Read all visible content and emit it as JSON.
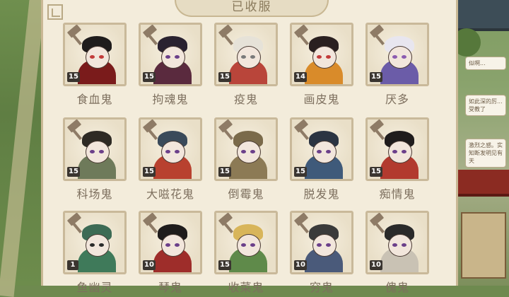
{
  "header": {
    "title": "已收服"
  },
  "ghosts": [
    {
      "name": "食血鬼",
      "level": "15",
      "color": "#7a1b1b",
      "hair": "#1f1c1c",
      "eye": "#c23b3b"
    },
    {
      "name": "拘魂鬼",
      "level": "15",
      "color": "#5a2a3e",
      "hair": "#2a2230",
      "eye": "#6b3f8a"
    },
    {
      "name": "疫鬼",
      "level": "15",
      "color": "#b9453a",
      "hair": "#e6e2d8",
      "eye": "#7a7a7a"
    },
    {
      "name": "画皮鬼",
      "level": "14",
      "color": "#d98b2a",
      "hair": "#2a2020",
      "eye": "#c23b3b"
    },
    {
      "name": "厌多",
      "level": "15",
      "color": "#6b5ca8",
      "hair": "#e8e6ef",
      "eye": "#8c5bb0"
    },
    {
      "name": "科场鬼",
      "level": "15",
      "color": "#6e7a5a",
      "hair": "#2e2a24",
      "eye": "#6b3f8a"
    },
    {
      "name": "大嗞花鬼",
      "level": "15",
      "color": "#b8412f",
      "hair": "#3a4a5a",
      "eye": "#6b3f8a"
    },
    {
      "name": "倒霉鬼",
      "level": "15",
      "color": "#8c7a55",
      "hair": "#7a6a4a",
      "eye": "#6b3f8a"
    },
    {
      "name": "脱发鬼",
      "level": "15",
      "color": "#3f5a7a",
      "hair": "#2b3442",
      "eye": "#6b3f8a"
    },
    {
      "name": "痴情鬼",
      "level": "15",
      "color": "#b23a2e",
      "hair": "#1f1c1c",
      "eye": "#6b3f8a"
    },
    {
      "name": "鱼幽灵",
      "level": "1",
      "color": "#3f7a5a",
      "hair": "#3d6b55",
      "eye": "#2a2a2a"
    },
    {
      "name": "琴鬼",
      "level": "10",
      "color": "#9e2d2a",
      "hair": "#1f1c1c",
      "eye": "#6b3f8a"
    },
    {
      "name": "收菜鬼",
      "level": "15",
      "color": "#5f8a4a",
      "hair": "#d8b55a",
      "eye": "#6b3f8a"
    },
    {
      "name": "穷鬼",
      "level": "10",
      "color": "#4a5a7a",
      "hair": "#3a3a3a",
      "eye": "#6b3f8a"
    },
    {
      "name": "傀鬼",
      "level": "10",
      "color": "#c9c2b4",
      "hair": "#2a2a2a",
      "eye": "#6b3f8a"
    }
  ],
  "side_chat": [
    "似啊...",
    "如此深的厉...受教了",
    "激烈之感。实知断发明见有天"
  ]
}
